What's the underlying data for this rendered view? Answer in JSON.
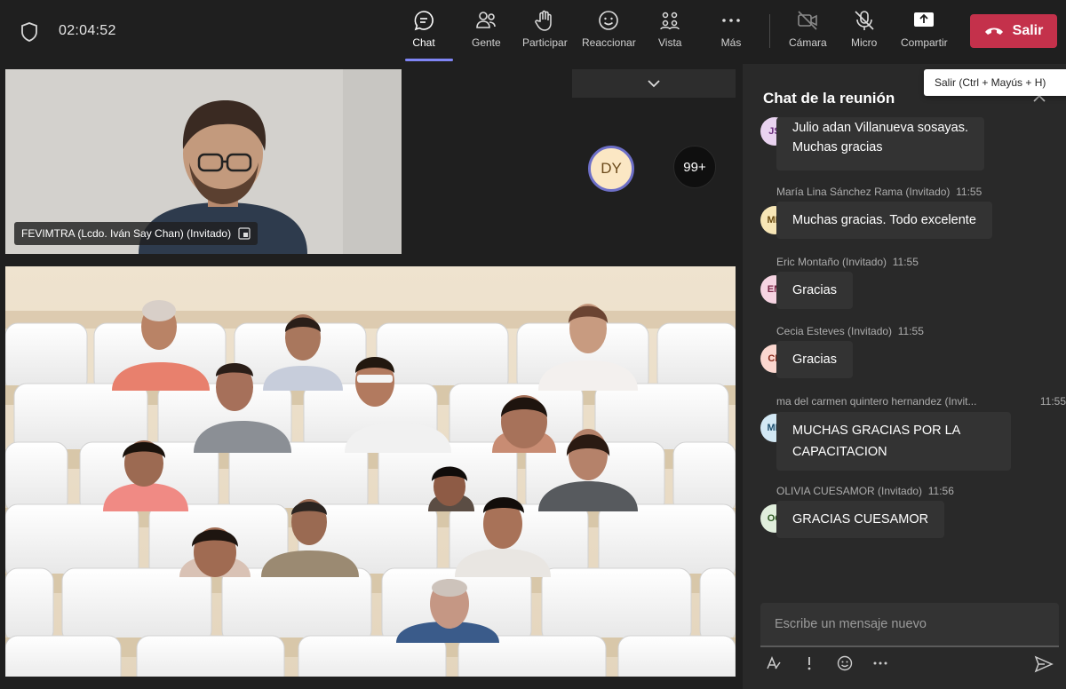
{
  "meeting": {
    "timer": "02:04:52"
  },
  "toolbar": {
    "chat": "Chat",
    "people": "Gente",
    "raise": "Participar",
    "react": "Reaccionar",
    "view": "Vista",
    "more": "Más",
    "camera": "Cámara",
    "mic": "Micro",
    "share": "Compartir",
    "leave": "Salir",
    "leave_tooltip": "Salir (Ctrl + Mayús + H)"
  },
  "stage": {
    "presenter_name": "FEVIMTRA (Lcdo. Iván Say Chan) (Invitado)",
    "avatar_initials": "DY",
    "overflow_count": "99+"
  },
  "chat": {
    "title": "Chat de la reunión",
    "placeholder": "Escribe un mensaje nuevo",
    "messages": [
      {
        "initials": "JS",
        "sender": "Julio adan Villanueva sosayas.",
        "text": "Muchas gracias"
      },
      {
        "initials": "MR",
        "sender": "María Lina Sánchez Rama (Invitado)",
        "time": "11:55",
        "text": "Muchas gracias. Todo excelente"
      },
      {
        "initials": "EM",
        "sender": "Eric Montaño (Invitado)",
        "time": "11:55",
        "text": "Gracias"
      },
      {
        "initials": "CE",
        "sender": "Cecia Esteves (Invitado)",
        "time": "11:55",
        "text": "Gracias"
      },
      {
        "initials": "MH",
        "sender": "ma del carmen quintero hernandez (Invit...",
        "time": "11:55",
        "text_line1": "MUCHAS GRACIAS POR LA",
        "text_line2": "CAPACITACION"
      },
      {
        "initials": "OC",
        "sender": "OLIVIA CUESAMOR (Invitado)",
        "time": "11:56",
        "text": "GRACIAS CUESAMOR"
      }
    ]
  },
  "colors": {
    "accent": "#7f85f5",
    "leave_red": "#c4314b",
    "panel": "#292929",
    "bubble": "#333333"
  },
  "icons": [
    "shield-icon",
    "chat-icon",
    "people-icon",
    "hand-icon",
    "smile-icon",
    "view-icon",
    "more-icon",
    "camera-off-icon",
    "mic-off-icon",
    "share-icon",
    "phone-hangup-icon",
    "chevron-down-icon",
    "chevron-up-icon",
    "popout-icon",
    "format-icon",
    "attach-icon",
    "emoji-icon",
    "ellipsis-icon",
    "send-icon"
  ]
}
